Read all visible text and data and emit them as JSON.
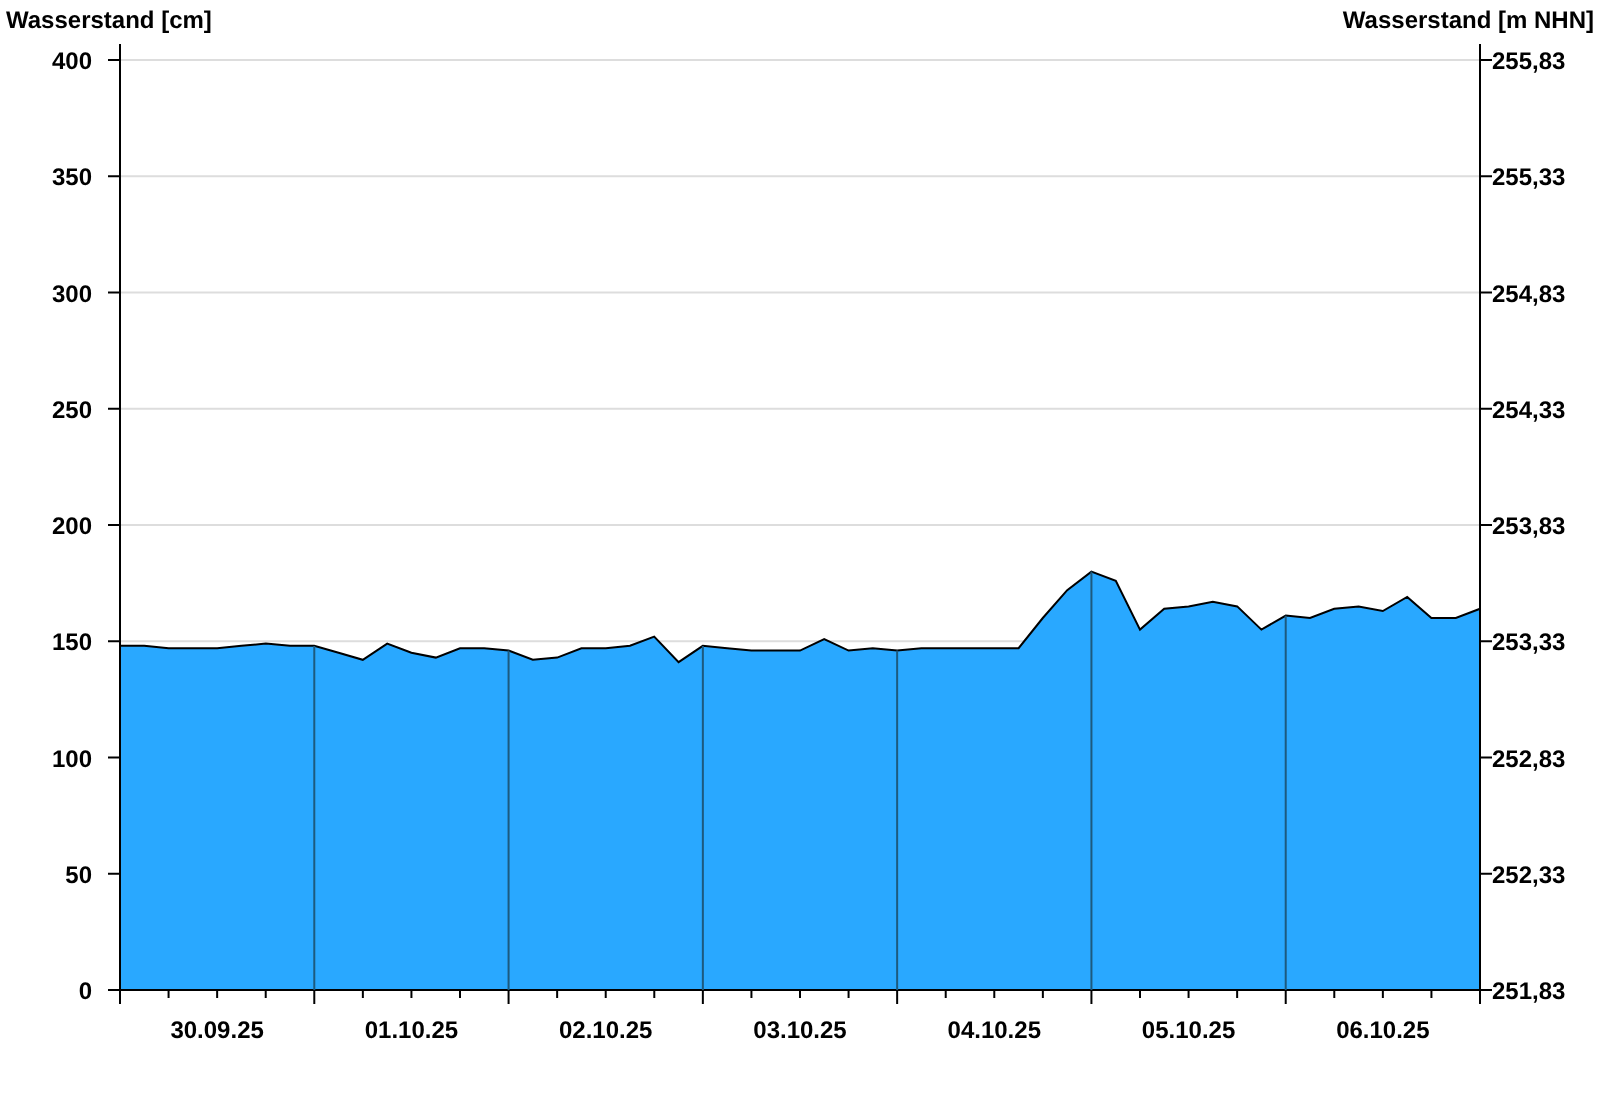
{
  "chart": {
    "chart_data": {
      "type": "area",
      "grid": true,
      "ylabel": "Wasserstand [cm]",
      "ylim": [
        0,
        400
      ],
      "yticks": [
        0,
        50,
        100,
        150,
        200,
        250,
        300,
        350,
        400
      ],
      "categories": [
        null,
        null,
        null,
        null,
        "30.09.25",
        null,
        null,
        null,
        null,
        null,
        null,
        null,
        "01.10.25",
        null,
        null,
        null,
        null,
        null,
        null,
        null,
        "02.10.25",
        null,
        null,
        null,
        null,
        null,
        null,
        null,
        "03.10.25",
        null,
        null,
        null,
        null,
        null,
        null,
        null,
        "04.10.25",
        null,
        null,
        null,
        null,
        null,
        null,
        null,
        "05.10.25",
        null,
        null,
        null,
        null,
        null,
        null,
        null,
        "06.10.25",
        null,
        null,
        null,
        null
      ],
      "series": [
        {
          "color": "#29a8ff",
          "values": [
            148,
            148,
            147,
            147,
            147,
            148,
            149,
            148,
            148,
            145,
            142,
            149,
            145,
            143,
            147,
            147,
            146,
            142,
            143,
            147,
            147,
            148,
            152,
            141,
            148,
            147,
            146,
            146,
            146,
            151,
            146,
            147,
            146,
            147,
            147,
            147,
            147,
            147,
            160,
            172,
            180,
            176,
            155,
            164,
            165,
            167,
            165,
            155,
            161,
            160,
            164,
            165,
            163,
            169,
            160,
            160,
            164
          ]
        }
      ]
    },
    "right_axis": {
      "title": "Wasserstand [m NHN]",
      "ticks": [
        "255,83",
        "255,33",
        "254,83",
        "254,33",
        "253,83",
        "253,33",
        "252,83",
        "252,33",
        "251,83"
      ]
    }
  }
}
